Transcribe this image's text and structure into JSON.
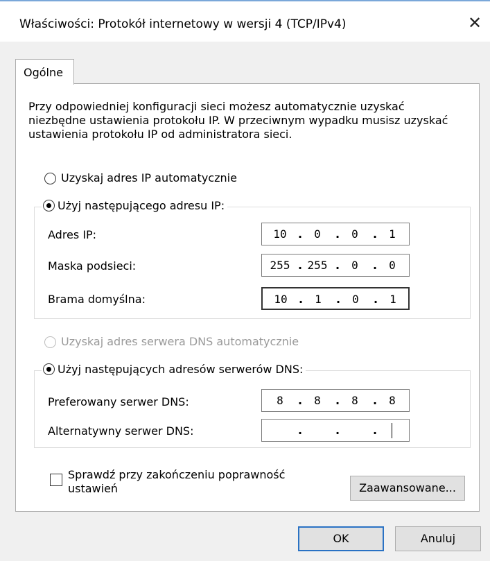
{
  "window": {
    "title": "Właściwości: Protokół internetowy w wersji 4 (TCP/IPv4)",
    "close_glyph": "✕"
  },
  "tab": {
    "label": "Ogólne"
  },
  "description": "Przy odpowiedniej konfiguracji sieci możesz automatycznie uzyskać niezbędne ustawienia protokołu IP. W przeciwnym wypadku musisz uzyskać ustawienia protokołu IP od administratora sieci.",
  "ip_section": {
    "auto_label": "Uzyskaj adres IP automatycznie",
    "auto_selected": false,
    "manual_label": "Użyj następującego adresu IP:",
    "manual_selected": true,
    "fields": {
      "ip": {
        "label": "Adres IP:",
        "octets": [
          "10",
          "0",
          "0",
          "1"
        ]
      },
      "mask": {
        "label": "Maska podsieci:",
        "octets": [
          "255",
          "255",
          "0",
          "0"
        ]
      },
      "gateway": {
        "label": "Brama domyślna:",
        "octets": [
          "10",
          "1",
          "0",
          "1"
        ]
      }
    }
  },
  "dns_section": {
    "auto_label": "Uzyskaj adres serwera DNS automatycznie",
    "auto_enabled": false,
    "manual_label": "Użyj następujących adresów serwerów DNS:",
    "manual_selected": true,
    "fields": {
      "preferred": {
        "label": "Preferowany serwer DNS:",
        "octets": [
          "8",
          "8",
          "8",
          "8"
        ]
      },
      "alternate": {
        "label": "Alternatywny serwer DNS:",
        "octets": [
          "",
          "",
          "",
          ""
        ]
      }
    }
  },
  "validate": {
    "line1": "Sprawdź przy zakończeniu poprawność",
    "line2": "ustawień",
    "checked": false
  },
  "buttons": {
    "advanced": "Zaawansowane...",
    "ok": "OK",
    "cancel": "Anuluj"
  },
  "colors": {
    "default_button_border": "#2a72c4",
    "title_accent": "#7aa7d9"
  }
}
